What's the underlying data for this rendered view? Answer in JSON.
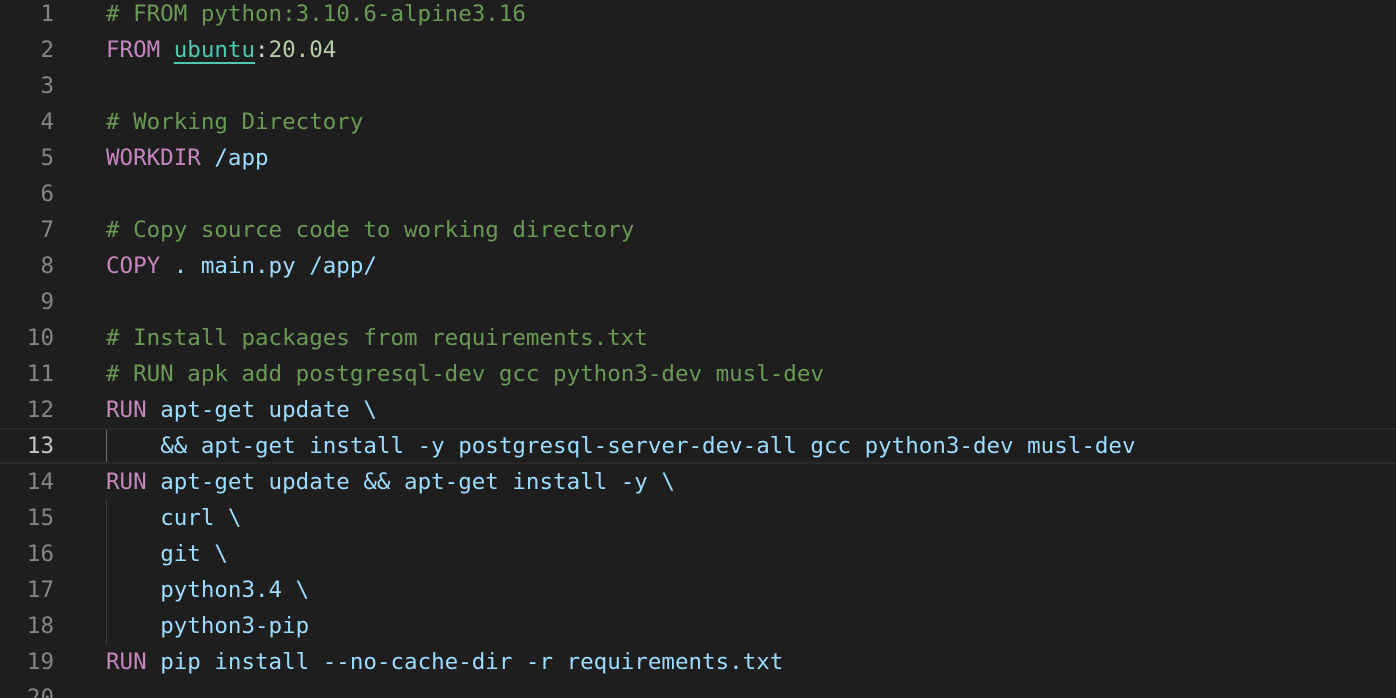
{
  "editor": {
    "language": "dockerfile",
    "current_line": 13,
    "colors": {
      "background": "#1e1e1e",
      "comment": "#6a9955",
      "keyword": "#c586c0",
      "argument": "#9cdcfe",
      "image": "#4ec9b0",
      "line_number": "#858585"
    },
    "lines": [
      {
        "number": "1",
        "segments": [
          {
            "type": "comment",
            "text": "# FROM python:3.10.6-alpine3.16"
          }
        ]
      },
      {
        "number": "2",
        "segments": [
          {
            "type": "keyword",
            "text": "FROM"
          },
          {
            "type": "punct",
            "text": " "
          },
          {
            "type": "image",
            "text": "ubuntu"
          },
          {
            "type": "punct",
            "text": ":"
          },
          {
            "type": "tag",
            "text": "20.04"
          }
        ]
      },
      {
        "number": "3",
        "segments": []
      },
      {
        "number": "4",
        "segments": [
          {
            "type": "comment",
            "text": "# Working Directory"
          }
        ]
      },
      {
        "number": "5",
        "segments": [
          {
            "type": "keyword",
            "text": "WORKDIR"
          },
          {
            "type": "punct",
            "text": " "
          },
          {
            "type": "arg",
            "text": "/app"
          }
        ]
      },
      {
        "number": "6",
        "segments": []
      },
      {
        "number": "7",
        "segments": [
          {
            "type": "comment",
            "text": "# Copy source code to working directory"
          }
        ]
      },
      {
        "number": "8",
        "segments": [
          {
            "type": "keyword",
            "text": "COPY"
          },
          {
            "type": "punct",
            "text": " "
          },
          {
            "type": "arg",
            "text": ". main.py /app/"
          }
        ]
      },
      {
        "number": "9",
        "segments": []
      },
      {
        "number": "10",
        "segments": [
          {
            "type": "comment",
            "text": "# Install packages from requirements.txt"
          }
        ]
      },
      {
        "number": "11",
        "segments": [
          {
            "type": "comment",
            "text": "# RUN apk add postgresql-dev gcc python3-dev musl-dev"
          }
        ]
      },
      {
        "number": "12",
        "segments": [
          {
            "type": "keyword",
            "text": "RUN"
          },
          {
            "type": "punct",
            "text": " "
          },
          {
            "type": "arg",
            "text": "apt-get update \\"
          }
        ]
      },
      {
        "number": "13",
        "segments": [
          {
            "type": "punct",
            "text": "    "
          },
          {
            "type": "arg",
            "text": "&& apt-get install -y postgresql-server-dev-all gcc python3-dev musl-dev"
          }
        ]
      },
      {
        "number": "14",
        "segments": [
          {
            "type": "keyword",
            "text": "RUN"
          },
          {
            "type": "punct",
            "text": " "
          },
          {
            "type": "arg",
            "text": "apt-get update && apt-get install -y \\"
          }
        ]
      },
      {
        "number": "15",
        "segments": [
          {
            "type": "punct",
            "text": "    "
          },
          {
            "type": "arg",
            "text": "curl \\"
          }
        ]
      },
      {
        "number": "16",
        "segments": [
          {
            "type": "punct",
            "text": "    "
          },
          {
            "type": "arg",
            "text": "git \\"
          }
        ]
      },
      {
        "number": "17",
        "segments": [
          {
            "type": "punct",
            "text": "    "
          },
          {
            "type": "arg",
            "text": "python3.4 \\"
          }
        ]
      },
      {
        "number": "18",
        "segments": [
          {
            "type": "punct",
            "text": "    "
          },
          {
            "type": "arg",
            "text": "python3-pip"
          }
        ]
      },
      {
        "number": "19",
        "segments": [
          {
            "type": "keyword",
            "text": "RUN"
          },
          {
            "type": "punct",
            "text": " "
          },
          {
            "type": "arg",
            "text": "pip install --no-cache-dir -r requirements.txt"
          }
        ]
      },
      {
        "number": "20",
        "segments": []
      }
    ]
  }
}
